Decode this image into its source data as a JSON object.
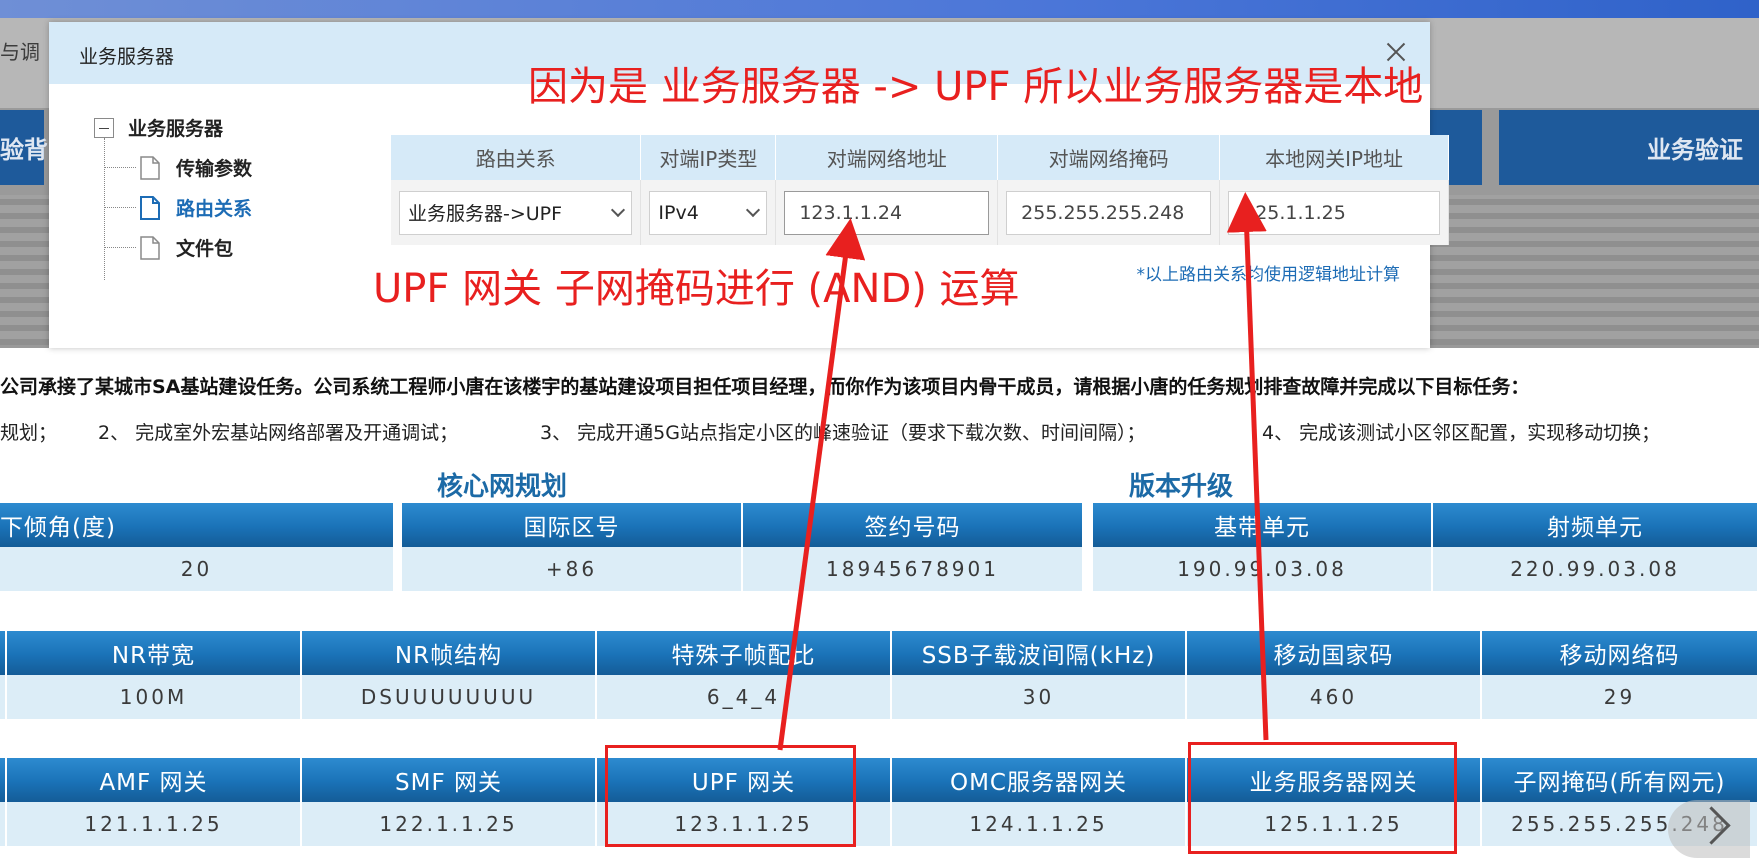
{
  "background": {
    "nav_left_top": "与调",
    "nav_left_mid": "验背",
    "tile_right": "业务验证"
  },
  "modal": {
    "title": "业务服务器",
    "tree": {
      "root": "业务服务器",
      "items": [
        "传输参数",
        "路由关系",
        "文件包"
      ],
      "active_item": "路由关系"
    },
    "route_table": {
      "headers": [
        "路由关系",
        "对端IP类型",
        "对端网络地址",
        "对端网络掩码",
        "本地网关IP地址"
      ],
      "row": {
        "route": "业务服务器->UPF",
        "ip_type": "IPv4",
        "peer_network": "123.1.1.24",
        "peer_mask": "255.255.255.248",
        "local_gateway": "125.1.1.25"
      }
    },
    "note": "*以上路由关系均使用逻辑地址计算"
  },
  "page": {
    "intro": "公司承接了某城市SA基站建设任务。公司系统工程师小唐在该楼宇的基站建设项目担任项目经理，而你作为该项目内骨干成员，请根据小唐的任务规划排查故障并完成以下目标任务：",
    "tasks": [
      "规划；",
      "2、 完成室外宏基站网络部署及开通调试；",
      "3、 完成开通5G站点指定小区的峰速验证（要求下载次数、时间间隔）；",
      "4、 完成该测试小区邻区配置，实现移动切换；"
    ],
    "section_core": "核心网规划",
    "section_version": "版本升级",
    "table1": {
      "headers": [
        "下倾角(度)",
        "国际区号",
        "签约号码",
        "基带单元",
        "射频单元"
      ],
      "values": [
        "20",
        "+86",
        "18945678901",
        "190.99.03.08",
        "220.99.03.08"
      ]
    },
    "table2": {
      "headers": [
        "NR带宽",
        "NR帧结构",
        "特殊子帧配比",
        "SSB子载波间隔(kHz)",
        "移动国家码",
        "移动网络码"
      ],
      "values": [
        "100M",
        "DSUUUUUUUU",
        "6_4_4",
        "30",
        "460",
        "29"
      ]
    },
    "table3": {
      "headers": [
        "AMF 网关",
        "SMF 网关",
        "UPF 网关",
        "OMC服务器网关",
        "业务服务器网关",
        "子网掩码(所有网元)"
      ],
      "values": [
        "121.1.1.25",
        "122.1.1.25",
        "123.1.1.25",
        "124.1.1.25",
        "125.1.1.25",
        "255.255.255.248"
      ]
    }
  },
  "annotations": {
    "top_text": "因为是 业务服务器 -> UPF 所以业务服务器是本地",
    "mid_text": "UPF 网关 子网掩码进行 (AND) 运算",
    "color": "#e8201f"
  },
  "colors": {
    "header_blue": "#1a72b7",
    "cell_light": "#dcedf7",
    "modal_header": "#d6eaf8",
    "link_blue": "#1d6cb5"
  }
}
